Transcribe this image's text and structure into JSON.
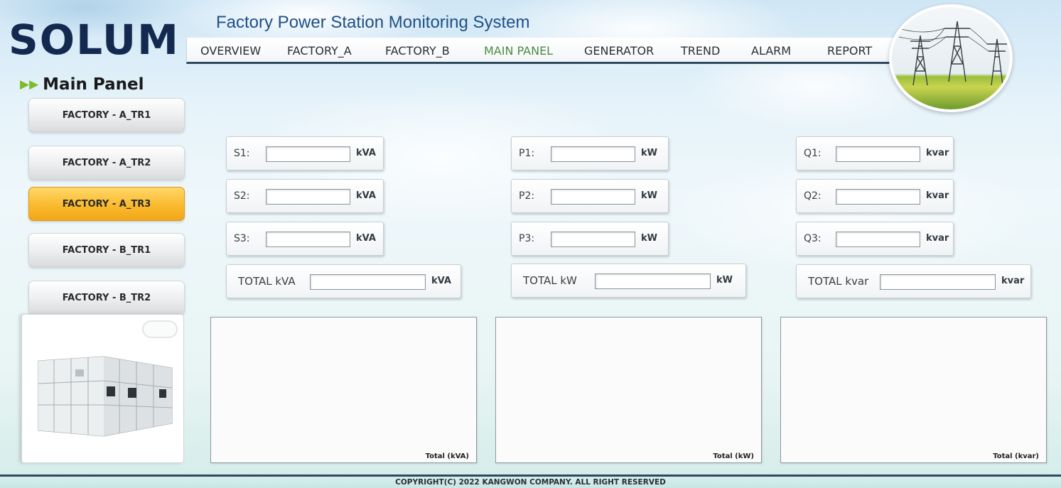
{
  "header": {
    "logo": "SOLUM",
    "title": "Factory Power Station Monitoring System"
  },
  "nav": [
    {
      "label": "OVERVIEW",
      "active": false
    },
    {
      "label": "FACTORY_A",
      "active": false
    },
    {
      "label": "FACTORY_B",
      "active": false
    },
    {
      "label": "MAIN PANEL",
      "active": true
    },
    {
      "label": "GENERATOR",
      "active": false
    },
    {
      "label": "TREND",
      "active": false
    },
    {
      "label": "ALARM",
      "active": false
    },
    {
      "label": "REPORT",
      "active": false
    }
  ],
  "page": {
    "title": "Main Panel",
    "title_icon": "double-arrow-icon"
  },
  "sidebar": [
    {
      "label": "FACTORY - A_TR1",
      "active": false
    },
    {
      "label": "FACTORY - A_TR2",
      "active": false
    },
    {
      "label": "FACTORY - A_TR3",
      "active": true
    },
    {
      "label": "FACTORY - B_TR1",
      "active": false
    },
    {
      "label": "FACTORY - B_TR2",
      "active": false
    }
  ],
  "panel_image": {
    "icon": "electrical-cabinet-image"
  },
  "columns": [
    {
      "fields": [
        {
          "label": "S1:",
          "value": "",
          "unit": "kVA"
        },
        {
          "label": "S2:",
          "value": "",
          "unit": "kVA"
        },
        {
          "label": "S3:",
          "value": "",
          "unit": "kVA"
        }
      ],
      "total": {
        "label": "TOTAL kVA",
        "value": "",
        "unit": "kVA"
      },
      "chart_caption": "Total (kVA)"
    },
    {
      "fields": [
        {
          "label": "P1:",
          "value": "",
          "unit": "kW"
        },
        {
          "label": "P2:",
          "value": "",
          "unit": "kW"
        },
        {
          "label": "P3:",
          "value": "",
          "unit": "kW"
        }
      ],
      "total": {
        "label": "TOTAL kW",
        "value": "",
        "unit": "kW"
      },
      "chart_caption": "Total (kW)"
    },
    {
      "fields": [
        {
          "label": "Q1:",
          "value": "",
          "unit": "kvar"
        },
        {
          "label": "Q2:",
          "value": "",
          "unit": "kvar"
        },
        {
          "label": "Q3:",
          "value": "",
          "unit": "kvar"
        }
      ],
      "total": {
        "label": "TOTAL kvar",
        "value": "",
        "unit": "kvar"
      },
      "chart_caption": "Total (kvar)"
    }
  ],
  "footer": {
    "copyright": "COPYRIGHT(C) 2022 KANGWON COMPANY. ALL RIGHT RESERVED"
  },
  "colors": {
    "brand_navy": "#14294f",
    "title_blue": "#1f4f86",
    "nav_active": "#4c8b43",
    "button_active": "#f9b82a"
  }
}
